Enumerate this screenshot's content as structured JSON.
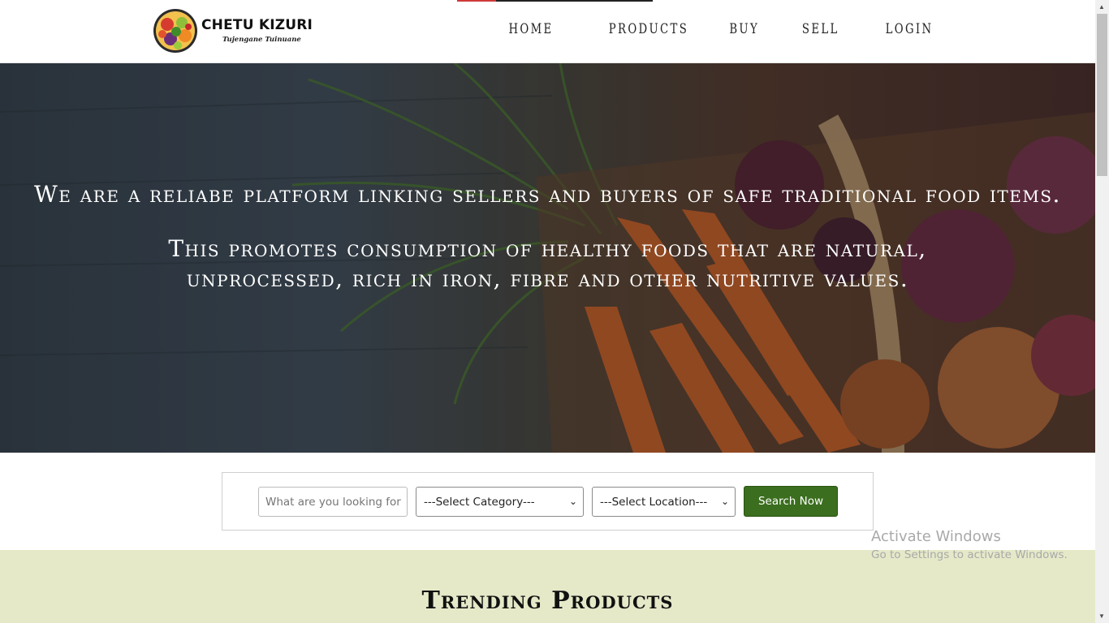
{
  "header": {
    "brand": "CHETU KIZURI",
    "tagline": "Tujengane Tuinuane",
    "progress": 0.2,
    "nav": [
      "HOME",
      "PRODUCTS",
      "BUY",
      "SELL",
      "LOGIN"
    ]
  },
  "hero": {
    "line1": "We are a reliabe platform linking sellers and buyers of safe traditional food items.",
    "line2": "This promotes consumption of healthy foods that are natural, unprocessed, rich in iron, fibre and other nutritive values."
  },
  "search": {
    "placeholder": "What are you looking for",
    "category": "---Select Category---",
    "location": "---Select Location---",
    "button": "Search Now"
  },
  "trending": {
    "title": "Trending Products"
  },
  "watermark": {
    "line1": "Activate Windows",
    "line2": "Go to Settings to activate Windows."
  },
  "colors": {
    "accent": "#3b6e1e",
    "trending_bg": "#e5e9c8",
    "progress": "#d0393b"
  },
  "icons": {
    "scroll_up": "triangle-up-icon",
    "scroll_down": "triangle-down-icon",
    "select": "chevron-down-icon"
  }
}
